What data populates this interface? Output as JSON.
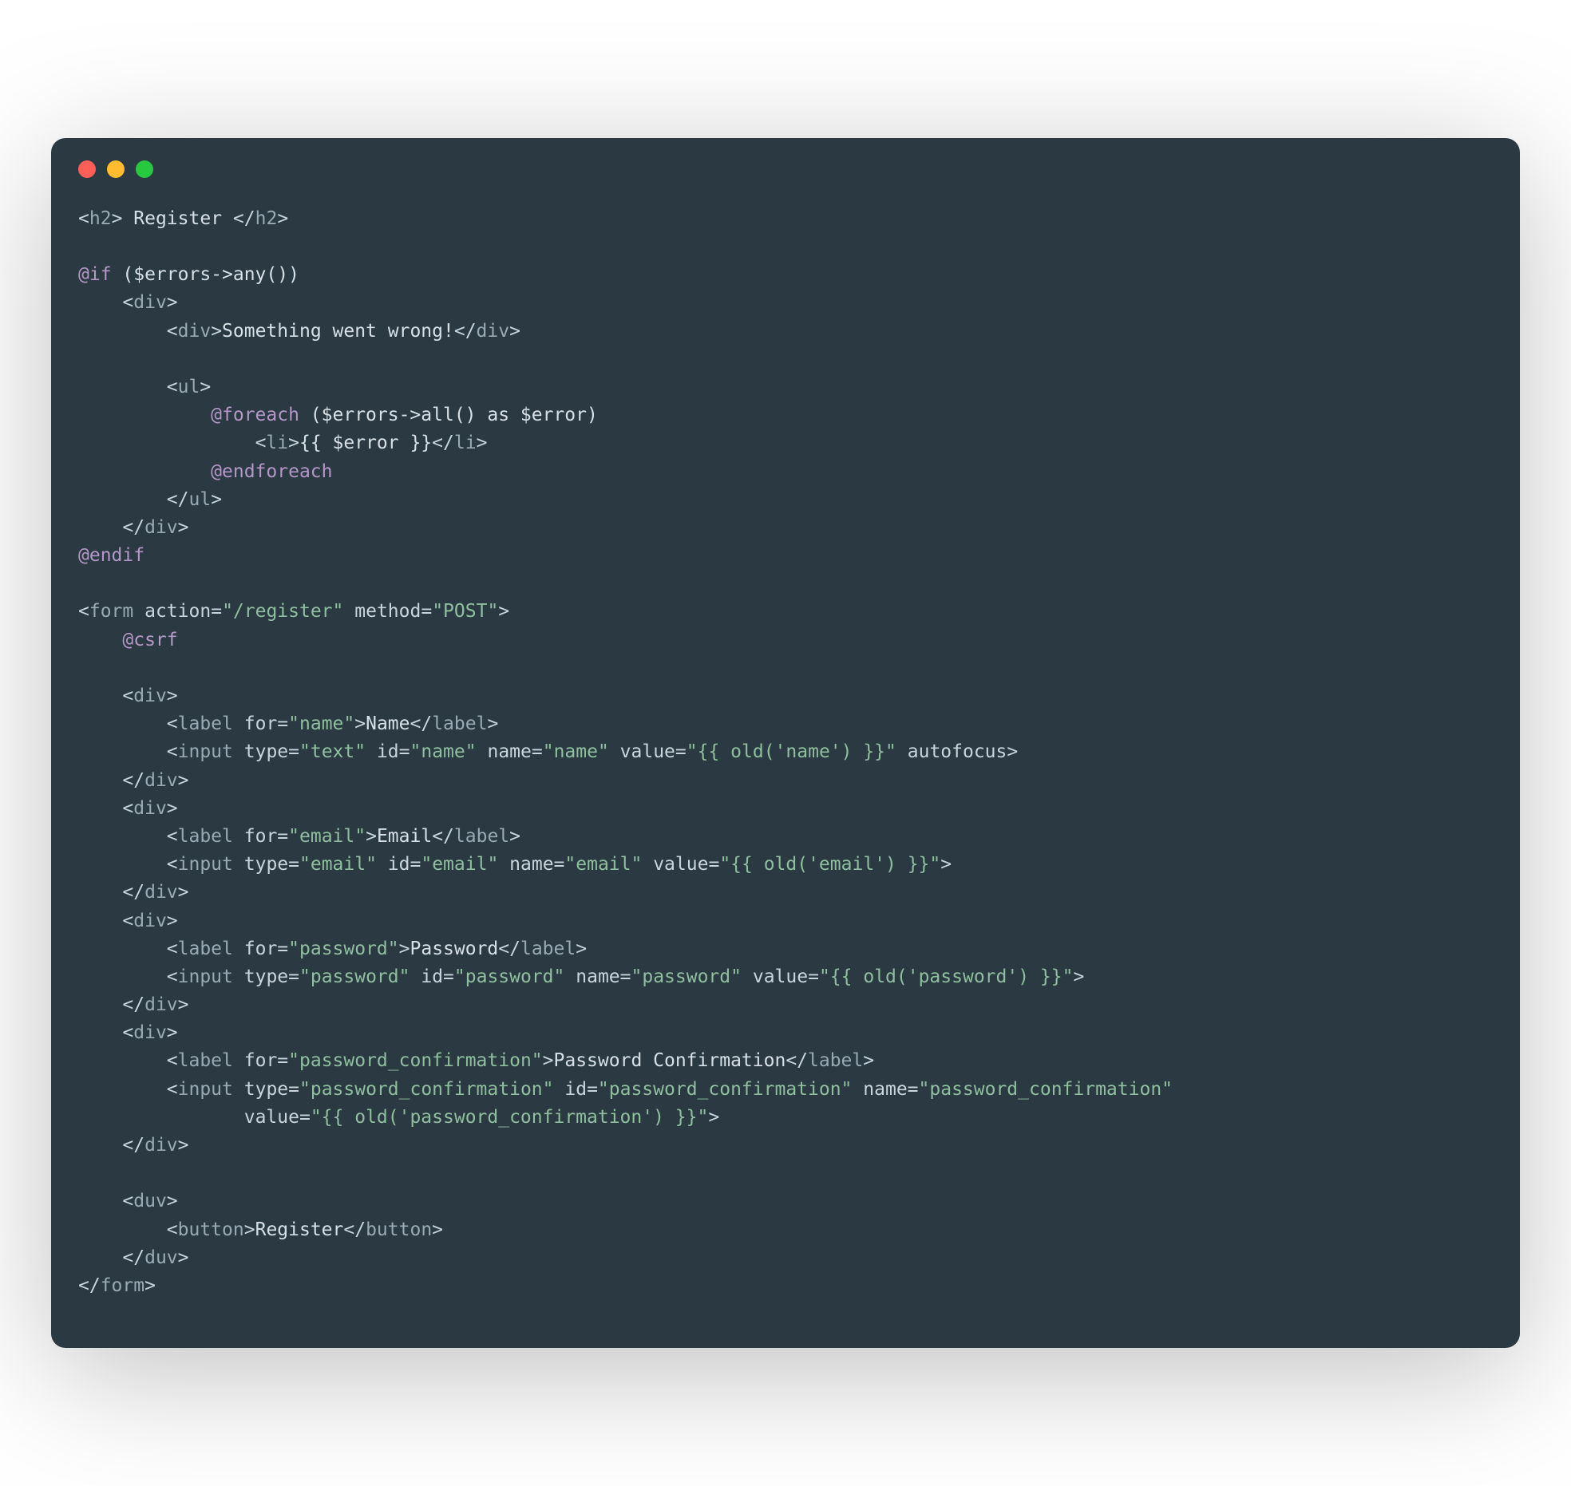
{
  "editor": {
    "theme": {
      "bg": "#2b3a42",
      "fg": "#d7e0e6",
      "tag": "#99aab5",
      "string": "#8fbf9f",
      "directive": "#b497c8",
      "dot_red": "#ff5f57",
      "dot_yellow": "#febc2e",
      "dot_green": "#28c840"
    },
    "lines": [
      {
        "indent": 0,
        "tokens": [
          {
            "t": "delim",
            "v": "<"
          },
          {
            "t": "tag",
            "v": "h2"
          },
          {
            "t": "delim",
            "v": ">"
          },
          {
            "t": "txt",
            "v": " Register "
          },
          {
            "t": "delim",
            "v": "</"
          },
          {
            "t": "tag",
            "v": "h2"
          },
          {
            "t": "delim",
            "v": ">"
          }
        ]
      },
      {
        "indent": 0,
        "tokens": []
      },
      {
        "indent": 0,
        "tokens": [
          {
            "t": "blade",
            "v": "@if"
          },
          {
            "t": "txt",
            "v": " ($errors->any())"
          }
        ]
      },
      {
        "indent": 1,
        "tokens": [
          {
            "t": "delim",
            "v": "<"
          },
          {
            "t": "tag",
            "v": "div"
          },
          {
            "t": "delim",
            "v": ">"
          }
        ]
      },
      {
        "indent": 2,
        "tokens": [
          {
            "t": "delim",
            "v": "<"
          },
          {
            "t": "tag",
            "v": "div"
          },
          {
            "t": "delim",
            "v": ">"
          },
          {
            "t": "txt",
            "v": "Something went wrong!"
          },
          {
            "t": "delim",
            "v": "</"
          },
          {
            "t": "tag",
            "v": "div"
          },
          {
            "t": "delim",
            "v": ">"
          }
        ]
      },
      {
        "indent": 0,
        "tokens": []
      },
      {
        "indent": 2,
        "tokens": [
          {
            "t": "delim",
            "v": "<"
          },
          {
            "t": "tag",
            "v": "ul"
          },
          {
            "t": "delim",
            "v": ">"
          }
        ]
      },
      {
        "indent": 3,
        "tokens": [
          {
            "t": "blade",
            "v": "@foreach"
          },
          {
            "t": "txt",
            "v": " ($errors->all() as $error)"
          }
        ]
      },
      {
        "indent": 4,
        "tokens": [
          {
            "t": "delim",
            "v": "<"
          },
          {
            "t": "tag",
            "v": "li"
          },
          {
            "t": "delim",
            "v": ">"
          },
          {
            "t": "txt",
            "v": "{{ $error }}"
          },
          {
            "t": "delim",
            "v": "</"
          },
          {
            "t": "tag",
            "v": "li"
          },
          {
            "t": "delim",
            "v": ">"
          }
        ]
      },
      {
        "indent": 3,
        "tokens": [
          {
            "t": "blade",
            "v": "@endforeach"
          }
        ]
      },
      {
        "indent": 2,
        "tokens": [
          {
            "t": "delim",
            "v": "</"
          },
          {
            "t": "tag",
            "v": "ul"
          },
          {
            "t": "delim",
            "v": ">"
          }
        ]
      },
      {
        "indent": 1,
        "tokens": [
          {
            "t": "delim",
            "v": "</"
          },
          {
            "t": "tag",
            "v": "div"
          },
          {
            "t": "delim",
            "v": ">"
          }
        ]
      },
      {
        "indent": 0,
        "tokens": [
          {
            "t": "blade",
            "v": "@endif"
          }
        ]
      },
      {
        "indent": 0,
        "tokens": []
      },
      {
        "indent": 0,
        "tokens": [
          {
            "t": "delim",
            "v": "<"
          },
          {
            "t": "tag",
            "v": "form"
          },
          {
            "t": "txt",
            "v": " "
          },
          {
            "t": "attr",
            "v": "action"
          },
          {
            "t": "eq",
            "v": "="
          },
          {
            "t": "str",
            "v": "\"/register\""
          },
          {
            "t": "txt",
            "v": " "
          },
          {
            "t": "attr",
            "v": "method"
          },
          {
            "t": "eq",
            "v": "="
          },
          {
            "t": "str",
            "v": "\"POST\""
          },
          {
            "t": "delim",
            "v": ">"
          }
        ]
      },
      {
        "indent": 1,
        "tokens": [
          {
            "t": "blade",
            "v": "@csrf"
          }
        ]
      },
      {
        "indent": 0,
        "tokens": []
      },
      {
        "indent": 1,
        "tokens": [
          {
            "t": "delim",
            "v": "<"
          },
          {
            "t": "tag",
            "v": "div"
          },
          {
            "t": "delim",
            "v": ">"
          }
        ]
      },
      {
        "indent": 2,
        "tokens": [
          {
            "t": "delim",
            "v": "<"
          },
          {
            "t": "tag",
            "v": "label"
          },
          {
            "t": "txt",
            "v": " "
          },
          {
            "t": "attr",
            "v": "for"
          },
          {
            "t": "eq",
            "v": "="
          },
          {
            "t": "str",
            "v": "\"name\""
          },
          {
            "t": "delim",
            "v": ">"
          },
          {
            "t": "txt",
            "v": "Name"
          },
          {
            "t": "delim",
            "v": "</"
          },
          {
            "t": "tag",
            "v": "label"
          },
          {
            "t": "delim",
            "v": ">"
          }
        ]
      },
      {
        "indent": 2,
        "tokens": [
          {
            "t": "delim",
            "v": "<"
          },
          {
            "t": "tag",
            "v": "input"
          },
          {
            "t": "txt",
            "v": " "
          },
          {
            "t": "attr",
            "v": "type"
          },
          {
            "t": "eq",
            "v": "="
          },
          {
            "t": "str",
            "v": "\"text\""
          },
          {
            "t": "txt",
            "v": " "
          },
          {
            "t": "attr",
            "v": "id"
          },
          {
            "t": "eq",
            "v": "="
          },
          {
            "t": "str",
            "v": "\"name\""
          },
          {
            "t": "txt",
            "v": " "
          },
          {
            "t": "attr",
            "v": "name"
          },
          {
            "t": "eq",
            "v": "="
          },
          {
            "t": "str",
            "v": "\"name\""
          },
          {
            "t": "txt",
            "v": " "
          },
          {
            "t": "attr",
            "v": "value"
          },
          {
            "t": "eq",
            "v": "="
          },
          {
            "t": "str",
            "v": "\"{{ old('name') }}\""
          },
          {
            "t": "txt",
            "v": " "
          },
          {
            "t": "attr",
            "v": "autofocus"
          },
          {
            "t": "delim",
            "v": ">"
          }
        ]
      },
      {
        "indent": 1,
        "tokens": [
          {
            "t": "delim",
            "v": "</"
          },
          {
            "t": "tag",
            "v": "div"
          },
          {
            "t": "delim",
            "v": ">"
          }
        ]
      },
      {
        "indent": 1,
        "tokens": [
          {
            "t": "delim",
            "v": "<"
          },
          {
            "t": "tag",
            "v": "div"
          },
          {
            "t": "delim",
            "v": ">"
          }
        ]
      },
      {
        "indent": 2,
        "tokens": [
          {
            "t": "delim",
            "v": "<"
          },
          {
            "t": "tag",
            "v": "label"
          },
          {
            "t": "txt",
            "v": " "
          },
          {
            "t": "attr",
            "v": "for"
          },
          {
            "t": "eq",
            "v": "="
          },
          {
            "t": "str",
            "v": "\"email\""
          },
          {
            "t": "delim",
            "v": ">"
          },
          {
            "t": "txt",
            "v": "Email"
          },
          {
            "t": "delim",
            "v": "</"
          },
          {
            "t": "tag",
            "v": "label"
          },
          {
            "t": "delim",
            "v": ">"
          }
        ]
      },
      {
        "indent": 2,
        "tokens": [
          {
            "t": "delim",
            "v": "<"
          },
          {
            "t": "tag",
            "v": "input"
          },
          {
            "t": "txt",
            "v": " "
          },
          {
            "t": "attr",
            "v": "type"
          },
          {
            "t": "eq",
            "v": "="
          },
          {
            "t": "str",
            "v": "\"email\""
          },
          {
            "t": "txt",
            "v": " "
          },
          {
            "t": "attr",
            "v": "id"
          },
          {
            "t": "eq",
            "v": "="
          },
          {
            "t": "str",
            "v": "\"email\""
          },
          {
            "t": "txt",
            "v": " "
          },
          {
            "t": "attr",
            "v": "name"
          },
          {
            "t": "eq",
            "v": "="
          },
          {
            "t": "str",
            "v": "\"email\""
          },
          {
            "t": "txt",
            "v": " "
          },
          {
            "t": "attr",
            "v": "value"
          },
          {
            "t": "eq",
            "v": "="
          },
          {
            "t": "str",
            "v": "\"{{ old('email') }}\""
          },
          {
            "t": "delim",
            "v": ">"
          }
        ]
      },
      {
        "indent": 1,
        "tokens": [
          {
            "t": "delim",
            "v": "</"
          },
          {
            "t": "tag",
            "v": "div"
          },
          {
            "t": "delim",
            "v": ">"
          }
        ]
      },
      {
        "indent": 1,
        "tokens": [
          {
            "t": "delim",
            "v": "<"
          },
          {
            "t": "tag",
            "v": "div"
          },
          {
            "t": "delim",
            "v": ">"
          }
        ]
      },
      {
        "indent": 2,
        "tokens": [
          {
            "t": "delim",
            "v": "<"
          },
          {
            "t": "tag",
            "v": "label"
          },
          {
            "t": "txt",
            "v": " "
          },
          {
            "t": "attr",
            "v": "for"
          },
          {
            "t": "eq",
            "v": "="
          },
          {
            "t": "str",
            "v": "\"password\""
          },
          {
            "t": "delim",
            "v": ">"
          },
          {
            "t": "txt",
            "v": "Password"
          },
          {
            "t": "delim",
            "v": "</"
          },
          {
            "t": "tag",
            "v": "label"
          },
          {
            "t": "delim",
            "v": ">"
          }
        ]
      },
      {
        "indent": 2,
        "tokens": [
          {
            "t": "delim",
            "v": "<"
          },
          {
            "t": "tag",
            "v": "input"
          },
          {
            "t": "txt",
            "v": " "
          },
          {
            "t": "attr",
            "v": "type"
          },
          {
            "t": "eq",
            "v": "="
          },
          {
            "t": "str",
            "v": "\"password\""
          },
          {
            "t": "txt",
            "v": " "
          },
          {
            "t": "attr",
            "v": "id"
          },
          {
            "t": "eq",
            "v": "="
          },
          {
            "t": "str",
            "v": "\"password\""
          },
          {
            "t": "txt",
            "v": " "
          },
          {
            "t": "attr",
            "v": "name"
          },
          {
            "t": "eq",
            "v": "="
          },
          {
            "t": "str",
            "v": "\"password\""
          },
          {
            "t": "txt",
            "v": " "
          },
          {
            "t": "attr",
            "v": "value"
          },
          {
            "t": "eq",
            "v": "="
          },
          {
            "t": "str",
            "v": "\"{{ old('password') }}\""
          },
          {
            "t": "delim",
            "v": ">"
          }
        ]
      },
      {
        "indent": 1,
        "tokens": [
          {
            "t": "delim",
            "v": "</"
          },
          {
            "t": "tag",
            "v": "div"
          },
          {
            "t": "delim",
            "v": ">"
          }
        ]
      },
      {
        "indent": 1,
        "tokens": [
          {
            "t": "delim",
            "v": "<"
          },
          {
            "t": "tag",
            "v": "div"
          },
          {
            "t": "delim",
            "v": ">"
          }
        ]
      },
      {
        "indent": 2,
        "tokens": [
          {
            "t": "delim",
            "v": "<"
          },
          {
            "t": "tag",
            "v": "label"
          },
          {
            "t": "txt",
            "v": " "
          },
          {
            "t": "attr",
            "v": "for"
          },
          {
            "t": "eq",
            "v": "="
          },
          {
            "t": "str",
            "v": "\"password_confirmation\""
          },
          {
            "t": "delim",
            "v": ">"
          },
          {
            "t": "txt",
            "v": "Password Confirmation"
          },
          {
            "t": "delim",
            "v": "</"
          },
          {
            "t": "tag",
            "v": "label"
          },
          {
            "t": "delim",
            "v": ">"
          }
        ]
      },
      {
        "indent": 2,
        "tokens": [
          {
            "t": "delim",
            "v": "<"
          },
          {
            "t": "tag",
            "v": "input"
          },
          {
            "t": "txt",
            "v": " "
          },
          {
            "t": "attr",
            "v": "type"
          },
          {
            "t": "eq",
            "v": "="
          },
          {
            "t": "str",
            "v": "\"password_confirmation\""
          },
          {
            "t": "txt",
            "v": " "
          },
          {
            "t": "attr",
            "v": "id"
          },
          {
            "t": "eq",
            "v": "="
          },
          {
            "t": "str",
            "v": "\"password_confirmation\""
          },
          {
            "t": "txt",
            "v": " "
          },
          {
            "t": "attr",
            "v": "name"
          },
          {
            "t": "eq",
            "v": "="
          },
          {
            "t": "str",
            "v": "\"password_confirmation\""
          }
        ]
      },
      {
        "indent": 3,
        "tokens": [
          {
            "t": "txt",
            "v": "   "
          },
          {
            "t": "attr",
            "v": "value"
          },
          {
            "t": "eq",
            "v": "="
          },
          {
            "t": "str",
            "v": "\"{{ old('password_confirmation') }}\""
          },
          {
            "t": "delim",
            "v": ">"
          }
        ]
      },
      {
        "indent": 1,
        "tokens": [
          {
            "t": "delim",
            "v": "</"
          },
          {
            "t": "tag",
            "v": "div"
          },
          {
            "t": "delim",
            "v": ">"
          }
        ]
      },
      {
        "indent": 0,
        "tokens": []
      },
      {
        "indent": 1,
        "tokens": [
          {
            "t": "delim",
            "v": "<"
          },
          {
            "t": "tag",
            "v": "duv"
          },
          {
            "t": "delim",
            "v": ">"
          }
        ]
      },
      {
        "indent": 2,
        "tokens": [
          {
            "t": "delim",
            "v": "<"
          },
          {
            "t": "tag",
            "v": "button"
          },
          {
            "t": "delim",
            "v": ">"
          },
          {
            "t": "txt",
            "v": "Register"
          },
          {
            "t": "delim",
            "v": "</"
          },
          {
            "t": "tag",
            "v": "button"
          },
          {
            "t": "delim",
            "v": ">"
          }
        ]
      },
      {
        "indent": 1,
        "tokens": [
          {
            "t": "delim",
            "v": "</"
          },
          {
            "t": "tag",
            "v": "duv"
          },
          {
            "t": "delim",
            "v": ">"
          }
        ]
      },
      {
        "indent": 0,
        "tokens": [
          {
            "t": "delim",
            "v": "</"
          },
          {
            "t": "tag",
            "v": "form"
          },
          {
            "t": "delim",
            "v": ">"
          }
        ]
      }
    ]
  }
}
